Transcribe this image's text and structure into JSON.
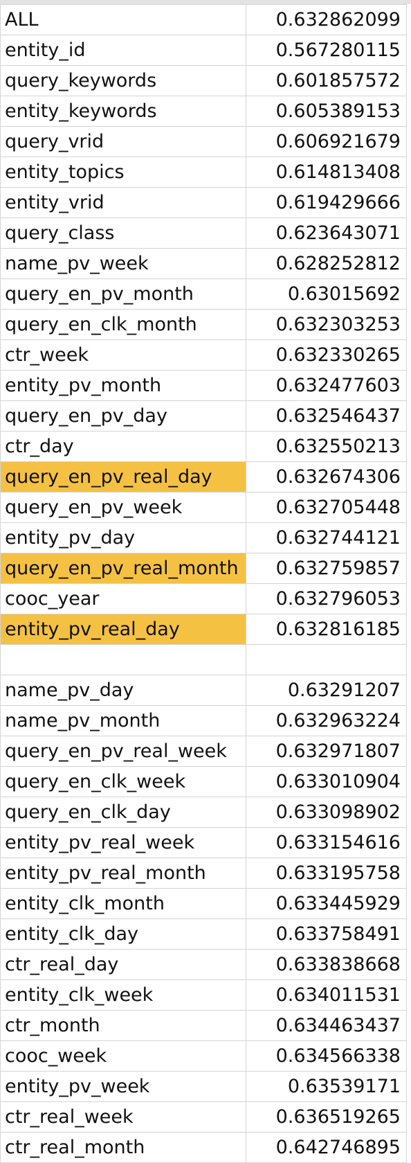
{
  "highlight_color": "#f5c143",
  "rows": [
    {
      "name": "ALL",
      "value": "0.632862099",
      "highlighted": false
    },
    {
      "name": "entity_id",
      "value": "0.567280115",
      "highlighted": false
    },
    {
      "name": "query_keywords",
      "value": "0.601857572",
      "highlighted": false
    },
    {
      "name": "entity_keywords",
      "value": "0.605389153",
      "highlighted": false
    },
    {
      "name": "query_vrid",
      "value": "0.606921679",
      "highlighted": false
    },
    {
      "name": "entity_topics",
      "value": "0.614813408",
      "highlighted": false
    },
    {
      "name": "entity_vrid",
      "value": "0.619429666",
      "highlighted": false
    },
    {
      "name": "query_class",
      "value": "0.623643071",
      "highlighted": false
    },
    {
      "name": "name_pv_week",
      "value": "0.628252812",
      "highlighted": false
    },
    {
      "name": "query_en_pv_month",
      "value": "0.63015692",
      "highlighted": false
    },
    {
      "name": "query_en_clk_month",
      "value": "0.632303253",
      "highlighted": false
    },
    {
      "name": "ctr_week",
      "value": "0.632330265",
      "highlighted": false
    },
    {
      "name": "entity_pv_month",
      "value": "0.632477603",
      "highlighted": false
    },
    {
      "name": "query_en_pv_day",
      "value": "0.632546437",
      "highlighted": false
    },
    {
      "name": "ctr_day",
      "value": "0.632550213",
      "highlighted": false
    },
    {
      "name": "query_en_pv_real_day",
      "value": "0.632674306",
      "highlighted": true
    },
    {
      "name": "query_en_pv_week",
      "value": "0.632705448",
      "highlighted": false
    },
    {
      "name": "entity_pv_day",
      "value": "0.632744121",
      "highlighted": false
    },
    {
      "name": "query_en_pv_real_month",
      "value": "0.632759857",
      "highlighted": true
    },
    {
      "name": "cooc_year",
      "value": "0.632796053",
      "highlighted": false
    },
    {
      "name": "entity_pv_real_day",
      "value": "0.632816185",
      "highlighted": true
    },
    {
      "name": "",
      "value": "",
      "highlighted": false,
      "blank": true
    },
    {
      "name": "name_pv_day",
      "value": "0.63291207",
      "highlighted": false
    },
    {
      "name": "name_pv_month",
      "value": "0.632963224",
      "highlighted": false
    },
    {
      "name": "query_en_pv_real_week",
      "value": "0.632971807",
      "highlighted": false
    },
    {
      "name": "query_en_clk_week",
      "value": "0.633010904",
      "highlighted": false
    },
    {
      "name": "query_en_clk_day",
      "value": "0.633098902",
      "highlighted": false
    },
    {
      "name": "entity_pv_real_week",
      "value": "0.633154616",
      "highlighted": false
    },
    {
      "name": "entity_pv_real_month",
      "value": "0.633195758",
      "highlighted": false
    },
    {
      "name": "entity_clk_month",
      "value": "0.633445929",
      "highlighted": false
    },
    {
      "name": "entity_clk_day",
      "value": "0.633758491",
      "highlighted": false
    },
    {
      "name": "ctr_real_day",
      "value": "0.633838668",
      "highlighted": false
    },
    {
      "name": "entity_clk_week",
      "value": "0.634011531",
      "highlighted": false
    },
    {
      "name": "ctr_month",
      "value": "0.634463437",
      "highlighted": false
    },
    {
      "name": "cooc_week",
      "value": "0.634566338",
      "highlighted": false
    },
    {
      "name": "entity_pv_week",
      "value": "0.63539171",
      "highlighted": false
    },
    {
      "name": "ctr_real_week",
      "value": "0.636519265",
      "highlighted": false
    },
    {
      "name": "ctr_real_month",
      "value": "0.642746895",
      "highlighted": false
    }
  ]
}
